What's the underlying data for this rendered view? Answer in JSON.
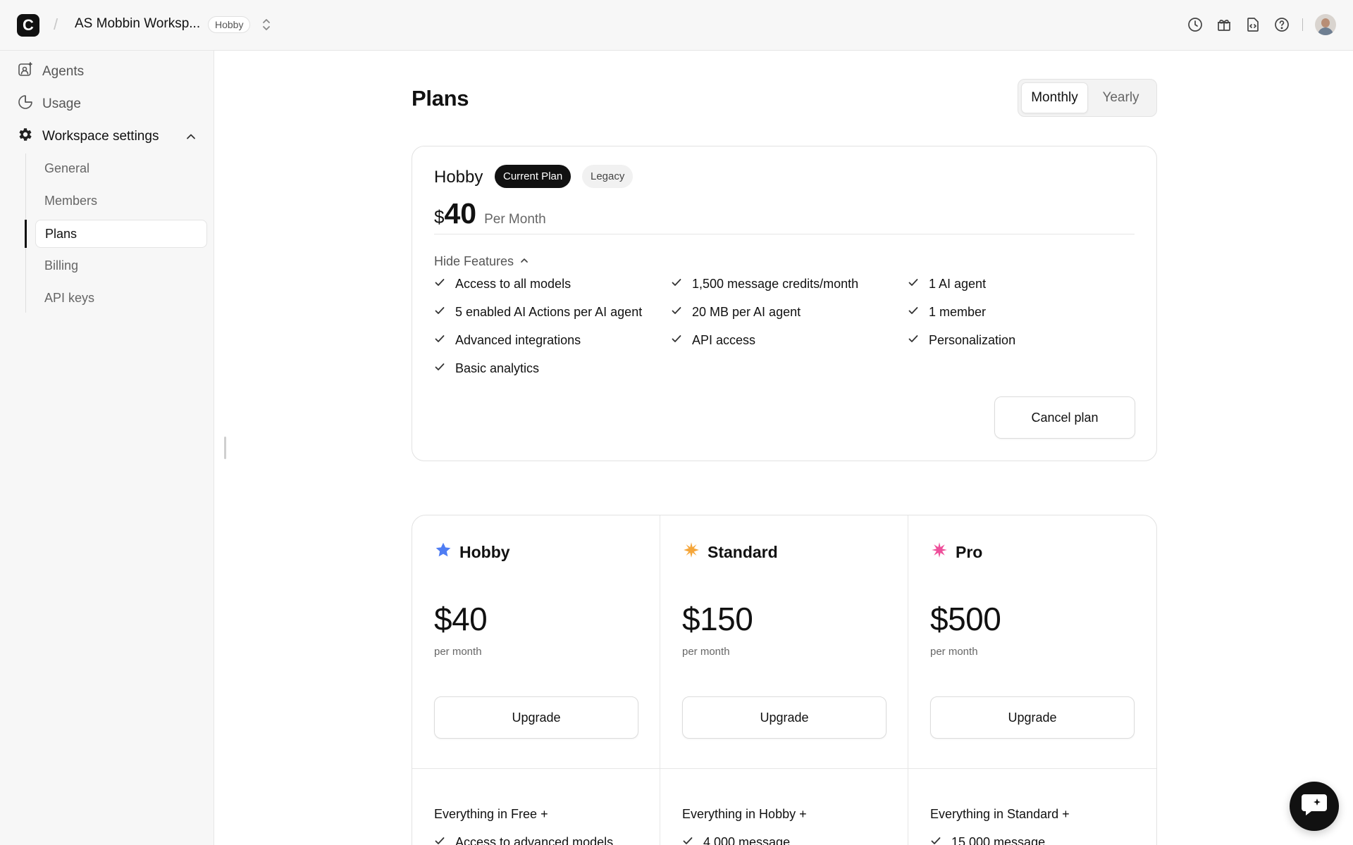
{
  "topbar": {
    "logo_letter": "C",
    "separator": "/",
    "workspace_name": "AS Mobbin Worksp...",
    "workspace_plan_badge": "Hobby",
    "icons": [
      "history-icon",
      "gift-icon",
      "code-file-icon",
      "help-icon"
    ]
  },
  "sidebar": {
    "items": [
      {
        "label": "Agents",
        "icon": "agents-icon"
      },
      {
        "label": "Usage",
        "icon": "usage-pie-icon"
      },
      {
        "label": "Workspace settings",
        "icon": "gear-icon"
      }
    ],
    "sub_items": [
      {
        "label": "General"
      },
      {
        "label": "Members"
      },
      {
        "label": "Plans",
        "active": true
      },
      {
        "label": "Billing"
      },
      {
        "label": "API keys"
      }
    ]
  },
  "main": {
    "title": "Plans",
    "billing_toggle": {
      "options": [
        "Monthly",
        "Yearly"
      ],
      "selected": "Monthly"
    },
    "current_plan": {
      "name": "Hobby",
      "badge_current": "Current Plan",
      "badge_legacy": "Legacy",
      "currency": "$",
      "amount": "40",
      "period": "Per Month",
      "toggle_label": "Hide Features",
      "features": [
        "Access to all models",
        "1,500 message credits/month",
        "1 AI agent",
        "5 enabled AI Actions per AI agent",
        "20 MB per AI agent",
        "1 member",
        "Advanced integrations",
        "API access",
        "Personalization",
        "Basic analytics"
      ],
      "cancel_label": "Cancel plan"
    },
    "plans": [
      {
        "name": "Hobby",
        "icon": "star-icon",
        "icon_color": "#4f7df3",
        "price": "$40",
        "period": "per month",
        "button": "Upgrade",
        "includes": "Everything in Free +",
        "first_feature": "Access to advanced models"
      },
      {
        "name": "Standard",
        "icon": "sparkle-icon",
        "icon_color": "#f5a63a",
        "price": "$150",
        "period": "per month",
        "button": "Upgrade",
        "includes": "Everything in Hobby +",
        "first_feature": "4,000 message"
      },
      {
        "name": "Pro",
        "icon": "burst-icon",
        "icon_color": "#ee4f9a",
        "price": "$500",
        "period": "per month",
        "button": "Upgrade",
        "includes": "Everything in Standard +",
        "first_feature": "15,000 message"
      }
    ]
  },
  "colors": {
    "accent": "#111111",
    "sidebar_bg": "#f7f7f7",
    "border": "#e2e2e2"
  }
}
